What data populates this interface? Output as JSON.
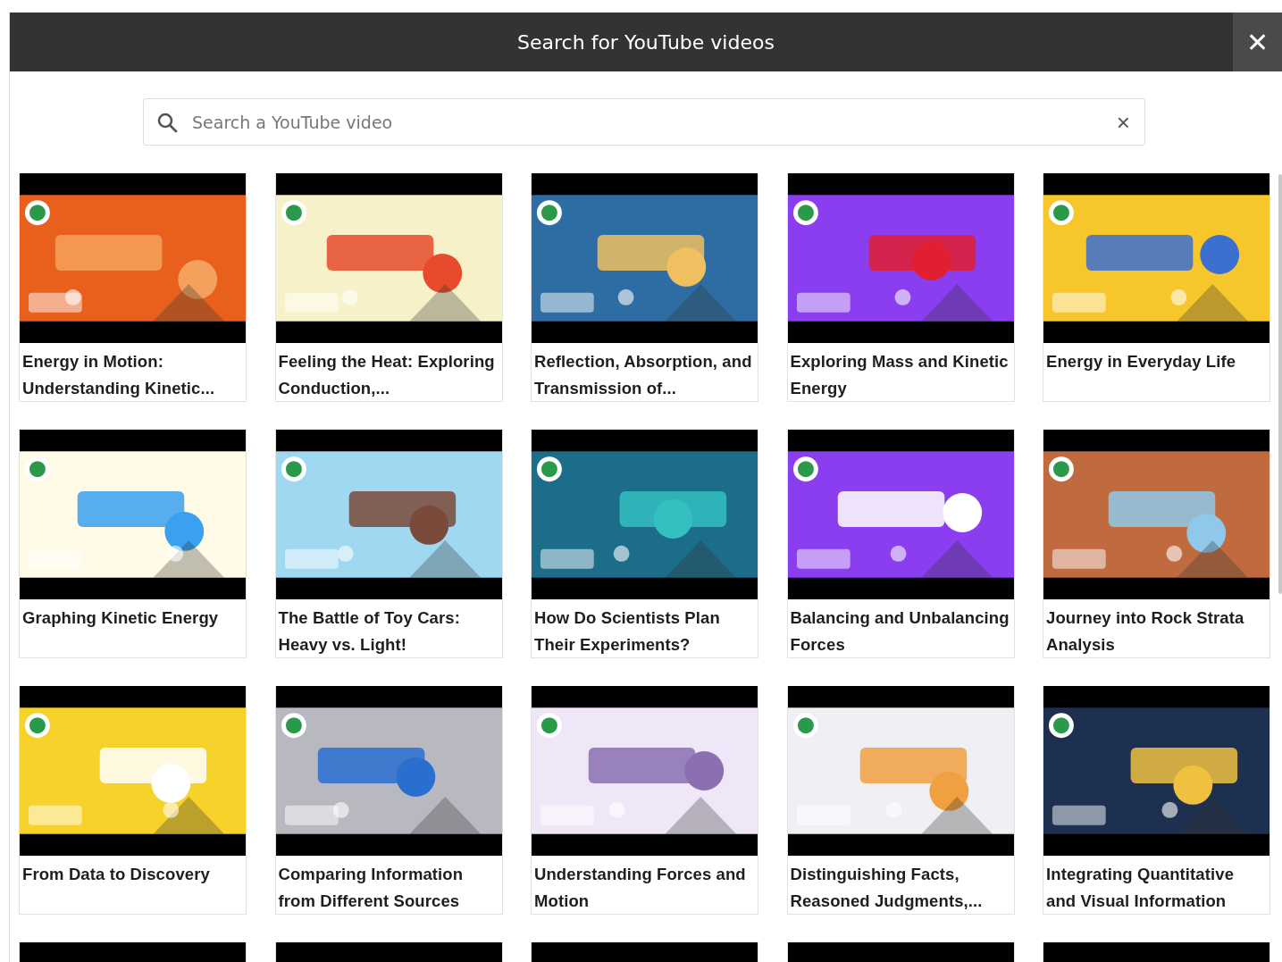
{
  "dialog": {
    "title": "Search for YouTube videos",
    "close": "✕"
  },
  "search": {
    "placeholder": "Search a YouTube video",
    "clear": "×"
  },
  "videos": [
    {
      "kind": "video",
      "title": "Energy in Motion: Understanding Kinetic..."
    },
    {
      "kind": "video",
      "title": "Feeling the Heat: Exploring Conduction,..."
    },
    {
      "kind": "video",
      "title": "Reflection, Absorption, and Transmission of..."
    },
    {
      "kind": "video",
      "title": "Exploring Mass and Kinetic Energy"
    },
    {
      "kind": "video",
      "title": "Energy in Everyday Life"
    },
    {
      "kind": "video",
      "title": "Graphing Kinetic Energy"
    },
    {
      "kind": "video",
      "title": "The Battle of Toy Cars: Heavy vs. Light!"
    },
    {
      "kind": "video",
      "title": "How Do Scientists Plan Their Experiments?"
    },
    {
      "kind": "video",
      "title": "Balancing and Unbalancing Forces"
    },
    {
      "kind": "video",
      "title": "Journey into Rock Strata Analysis"
    },
    {
      "kind": "video",
      "title": "From Data to Discovery"
    },
    {
      "kind": "video",
      "title": "Comparing Information from Different Sources"
    },
    {
      "kind": "video",
      "title": "Understanding Forces and Motion"
    },
    {
      "kind": "video",
      "title": "Distinguishing Facts, Reasoned Judgments,..."
    },
    {
      "kind": "video",
      "title": "Integrating Quantitative and Visual Information"
    },
    {
      "kind": "partial"
    },
    {
      "kind": "partial"
    },
    {
      "kind": "partial"
    },
    {
      "kind": "partial"
    },
    {
      "kind": "partial"
    }
  ]
}
